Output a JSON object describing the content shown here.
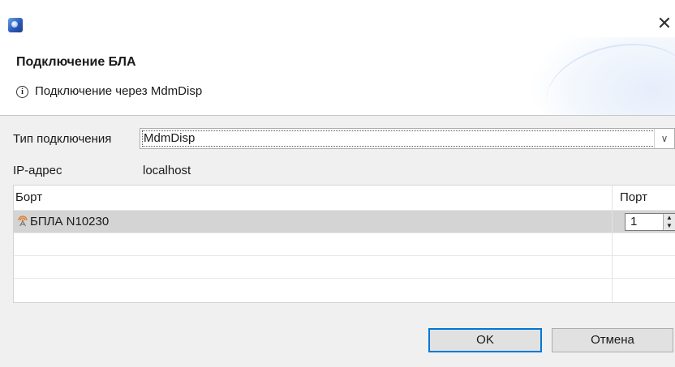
{
  "window": {
    "close_glyph": "✕",
    "app_icon": "eclipse-globe-icon"
  },
  "header": {
    "title": "Подключение БЛА",
    "info_icon": "info-icon",
    "message": "Подключение через MdmDisp"
  },
  "form": {
    "connection_type_label": "Тип подключения",
    "connection_type_value": "MdmDisp",
    "ip_label": "IP-адрес",
    "ip_value": "localhost"
  },
  "table": {
    "columns": [
      "Борт",
      "Порт"
    ],
    "rows": [
      {
        "name": "БПЛА N10230",
        "icon": "satellite-antenna-icon",
        "port": "1",
        "selected": true
      },
      {
        "name": "",
        "port": ""
      },
      {
        "name": "",
        "port": ""
      },
      {
        "name": "",
        "port": ""
      }
    ]
  },
  "buttons": {
    "ok": "OK",
    "cancel": "Отмена"
  },
  "colors": {
    "focus_border": "#0078d7",
    "selected_row": "#d4d4d4",
    "icon_orange": "#e07a1f"
  }
}
